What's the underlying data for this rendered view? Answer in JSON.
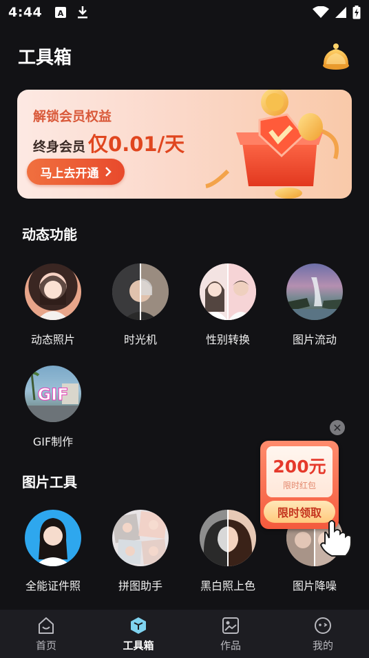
{
  "status_bar": {
    "time": "4:44"
  },
  "header": {
    "title": "工具箱"
  },
  "banner": {
    "line1": "解锁会员权益",
    "line2_prefix": "终身会员",
    "line2_price": "仅0.01/天",
    "button_label": "马上去开通"
  },
  "sections": {
    "dynamic": {
      "title": "动态功能",
      "items": [
        {
          "label": "动态照片"
        },
        {
          "label": "时光机"
        },
        {
          "label": "性别转换"
        },
        {
          "label": "图片流动"
        },
        {
          "label": "GIF制作",
          "icon_text": "GIF"
        }
      ]
    },
    "image_tools": {
      "title": "图片工具",
      "items": [
        {
          "label": "全能证件照"
        },
        {
          "label": "拼图助手"
        },
        {
          "label": "黑白照上色"
        },
        {
          "label": "图片降噪"
        }
      ]
    }
  },
  "promo": {
    "amount": "200元",
    "subtitle": "限时红包",
    "button_label": "限时领取"
  },
  "bottom_nav": [
    {
      "label": "首页",
      "icon": "home-icon"
    },
    {
      "label": "工具箱",
      "icon": "toolbox-icon",
      "active": true
    },
    {
      "label": "作品",
      "icon": "gallery-icon"
    },
    {
      "label": "我的",
      "icon": "profile-icon"
    }
  ],
  "colors": {
    "background": "#121215",
    "accent_orange": "#e84a2c",
    "toolbox_cyan": "#7fd3f0"
  }
}
